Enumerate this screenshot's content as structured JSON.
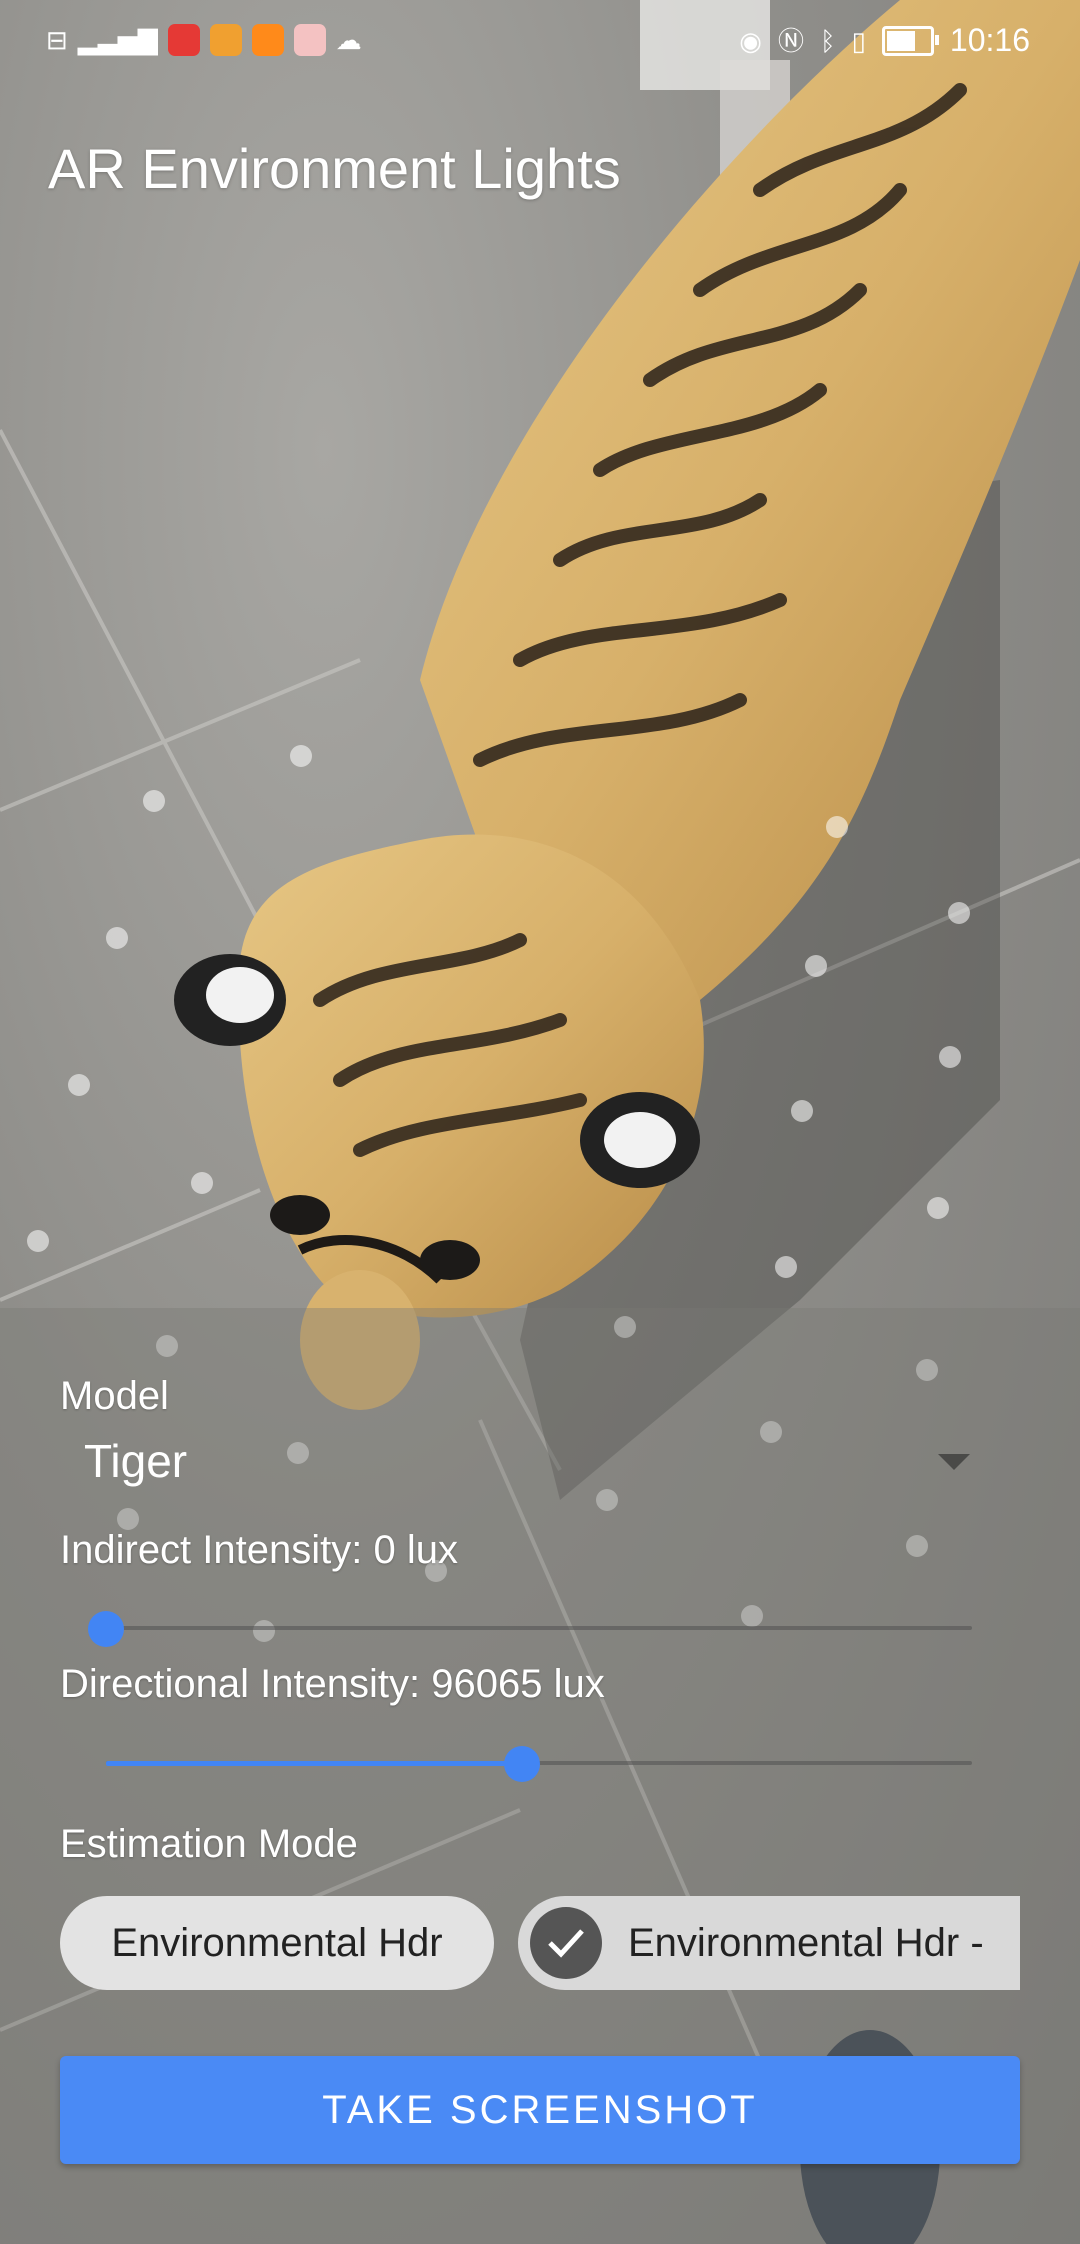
{
  "status_bar": {
    "left_icons": [
      "hd-icon",
      "4g-signal-icon",
      "video-app-icon",
      "news-app-icon",
      "player-app-icon",
      "gift-app-icon",
      "wechat-icon"
    ],
    "right_icons": [
      "eye-icon",
      "nfc-icon",
      "bluetooth-icon",
      "sim-icon",
      "battery-icon"
    ],
    "time": "10:16"
  },
  "app": {
    "title": "AR Environment Lights"
  },
  "controls": {
    "model_label": "Model",
    "model_value": "Tiger",
    "indirect_label": "Indirect Intensity: 0 lux",
    "indirect_value": 0,
    "directional_label": "Directional Intensity: 96065 lux",
    "directional_fraction": 0.48,
    "estimation_label": "Estimation Mode",
    "chips": [
      {
        "label": "Environmental Hdr",
        "selected": false
      },
      {
        "label": "Environmental Hdr -",
        "selected": true
      }
    ],
    "screenshot_button": "TAKE SCREENSHOT"
  },
  "colors": {
    "accent": "#4285f4",
    "button": "#4a8af5"
  }
}
